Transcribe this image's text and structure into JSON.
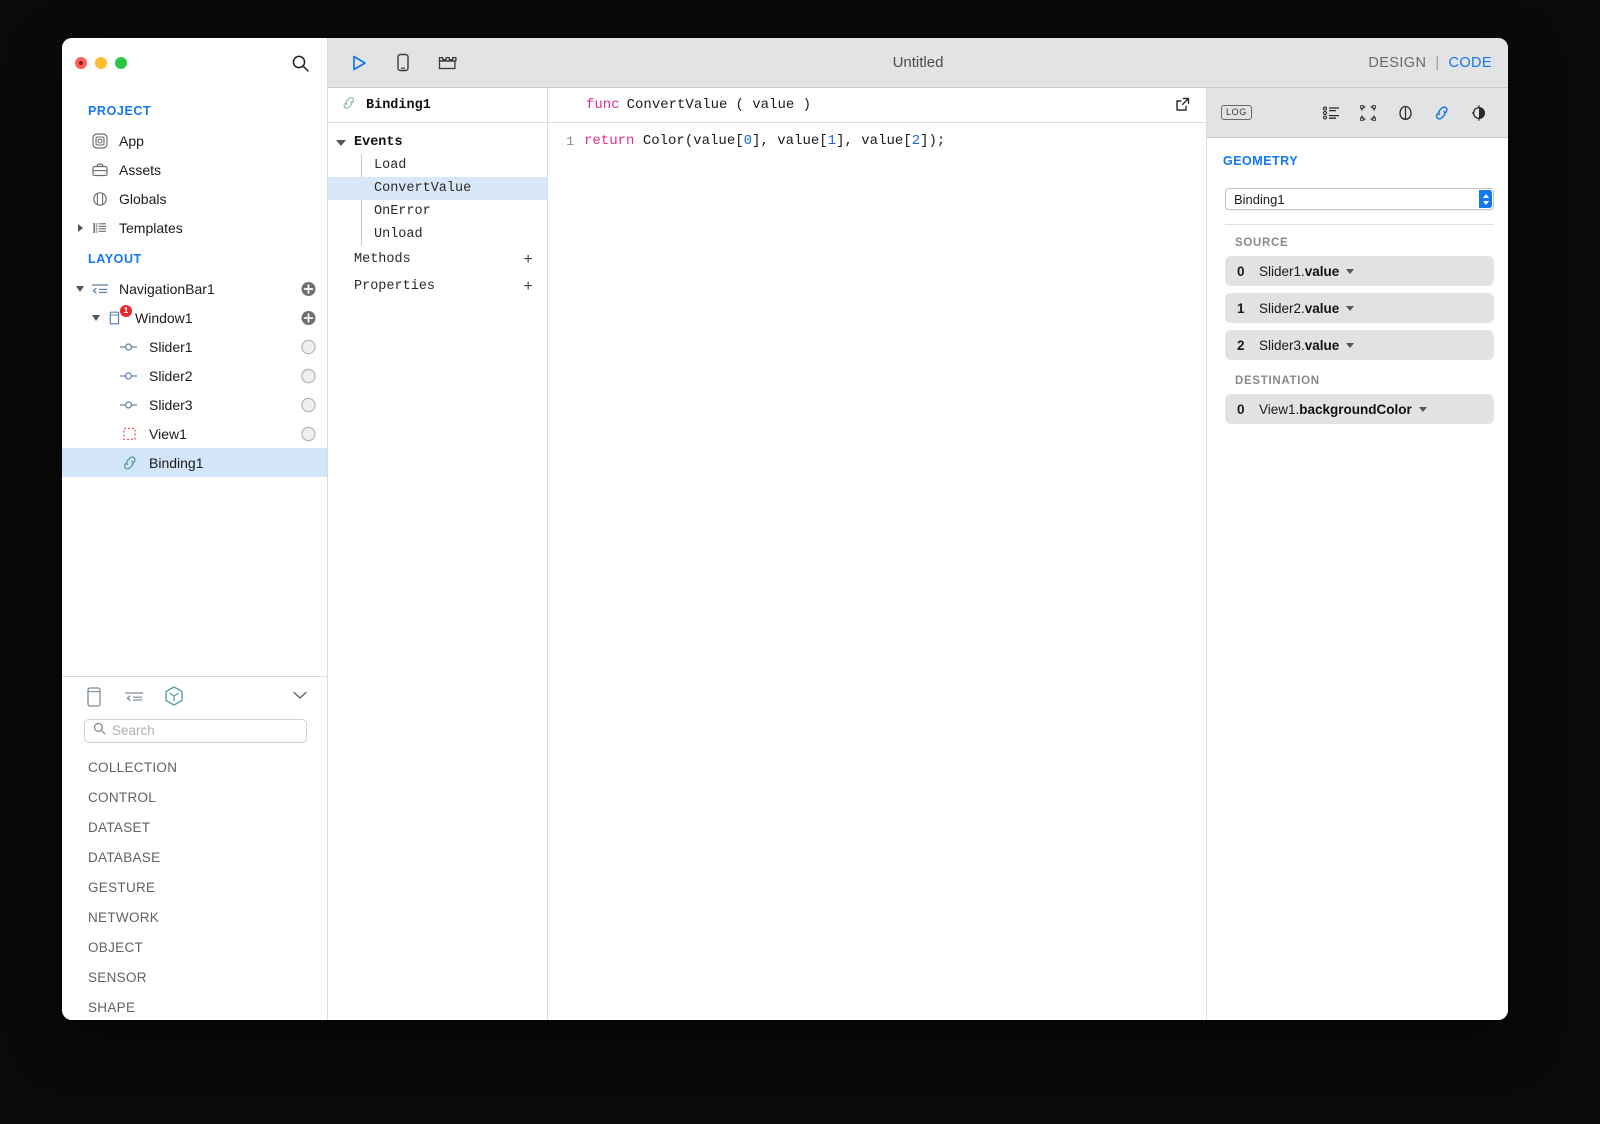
{
  "window": {
    "traffic_lights": [
      "close",
      "minimize",
      "zoom"
    ]
  },
  "sidebar": {
    "search_icon": "search-icon",
    "groups": [
      {
        "title": "PROJECT",
        "items": [
          {
            "label": "App",
            "icon": "app-icon",
            "twisty": "",
            "accessory": ""
          },
          {
            "label": "Assets",
            "icon": "assets-briefcase-icon",
            "twisty": "",
            "accessory": ""
          },
          {
            "label": "Globals",
            "icon": "globals-cylinder-icon",
            "twisty": "",
            "accessory": ""
          },
          {
            "label": "Templates",
            "icon": "templates-icon",
            "twisty": "collapsed",
            "accessory": ""
          }
        ]
      },
      {
        "title": "LAYOUT",
        "items": [
          {
            "label": "NavigationBar1",
            "icon": "navigationbar-icon",
            "twisty": "expanded",
            "accessory": "plus",
            "indent": 0
          },
          {
            "label": "Window1",
            "icon": "window-icon",
            "twisty": "expanded",
            "accessory": "plus",
            "indent": 1,
            "badge": "1"
          },
          {
            "label": "Slider1",
            "icon": "slider-icon",
            "twisty": "",
            "accessory": "circle",
            "indent": 2
          },
          {
            "label": "Slider2",
            "icon": "slider-icon",
            "twisty": "",
            "accessory": "circle",
            "indent": 2
          },
          {
            "label": "Slider3",
            "icon": "slider-icon",
            "twisty": "",
            "accessory": "circle",
            "indent": 2
          },
          {
            "label": "View1",
            "icon": "view-icon",
            "twisty": "",
            "accessory": "circle",
            "indent": 2
          },
          {
            "label": "Binding1",
            "icon": "binding-link-icon",
            "twisty": "",
            "accessory": "",
            "indent": 2,
            "selected": true
          }
        ]
      }
    ]
  },
  "library": {
    "tabs": [
      {
        "icon": "device-outline-icon",
        "active": false
      },
      {
        "icon": "navbar-icon",
        "active": false
      },
      {
        "icon": "hexagon-object-icon",
        "active": true
      }
    ],
    "collapse_icon": "chevron-down-icon",
    "search": {
      "placeholder": "Search",
      "value": "",
      "icon": "search-icon"
    },
    "categories": [
      "COLLECTION",
      "CONTROL",
      "DATASET",
      "DATABASE",
      "GESTURE",
      "NETWORK",
      "OBJECT",
      "SENSOR",
      "SHAPE"
    ]
  },
  "toolbar": {
    "run_icon": "play-icon",
    "device_icon": "device-preview-icon",
    "widget_icon": "widget-blocks-icon",
    "title": "Untitled",
    "design_label": "DESIGN",
    "separator": "|",
    "code_label": "CODE"
  },
  "outline": {
    "header": {
      "label": "Binding1",
      "icon": "binding-link-icon"
    },
    "sections": [
      {
        "label": "Events",
        "twisty": "expanded",
        "children": [
          {
            "label": "Load",
            "selected": false
          },
          {
            "label": "ConvertValue",
            "selected": true
          },
          {
            "label": "OnError",
            "selected": false
          },
          {
            "label": "Unload",
            "selected": false
          }
        ]
      }
    ],
    "rows": [
      {
        "label": "Methods",
        "plus": "+"
      },
      {
        "label": "Properties",
        "plus": "+"
      }
    ]
  },
  "code": {
    "signature": {
      "keyword": "func",
      "name": "ConvertValue",
      "params": "( value )"
    },
    "popout_icon": "open-external-icon",
    "lines": [
      {
        "number": "1",
        "tokens": [
          {
            "t": "return",
            "c": "kw"
          },
          {
            "t": " Color(value[",
            "c": "plain"
          },
          {
            "t": "0",
            "c": "num"
          },
          {
            "t": "], value[",
            "c": "plain"
          },
          {
            "t": "1",
            "c": "num"
          },
          {
            "t": "], value[",
            "c": "plain"
          },
          {
            "t": "2",
            "c": "num"
          },
          {
            "t": "]);",
            "c": "plain"
          }
        ]
      }
    ]
  },
  "inspector": {
    "log_label": "LOG",
    "icons": [
      {
        "name": "list-properties-icon",
        "active": false
      },
      {
        "name": "geometry-bounds-icon",
        "active": false
      },
      {
        "name": "appearance-icon",
        "active": false
      },
      {
        "name": "bindings-link-icon",
        "active": true
      },
      {
        "name": "preview-eye-icon",
        "active": false
      }
    ],
    "title": "GEOMETRY",
    "select": {
      "value": "Binding1"
    },
    "source_label": "SOURCE",
    "sources": [
      {
        "index": "0",
        "object": "Slider1.",
        "prop": "value"
      },
      {
        "index": "1",
        "object": "Slider2.",
        "prop": "value"
      },
      {
        "index": "2",
        "object": "Slider3.",
        "prop": "value"
      }
    ],
    "destination_label": "DESTINATION",
    "destinations": [
      {
        "index": "0",
        "object": "View1.",
        "prop": "backgroundColor"
      }
    ]
  },
  "colors": {
    "accent_blue": "#1277f0",
    "selection_blue": "#d3e5fb",
    "toolbar_gray": "#e3e3e5",
    "row_gray": "#e2e2e2",
    "badge_red": "#e8262a",
    "code_keyword": "#d8308f",
    "code_number": "#1b67e0",
    "teal_icon": "#5f9ea6"
  }
}
